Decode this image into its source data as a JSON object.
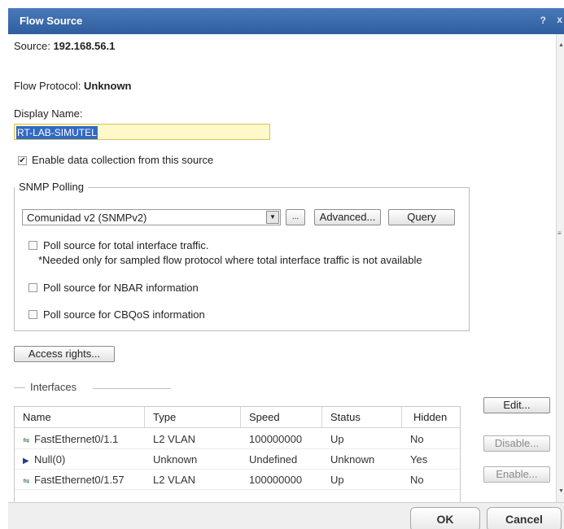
{
  "dialog": {
    "title": "Flow Source",
    "help": "?",
    "close": "x"
  },
  "source": {
    "label": "Source:",
    "value": "192.168.56.1"
  },
  "flow_protocol": {
    "label": "Flow Protocol:",
    "value": "Unknown"
  },
  "display_name": {
    "label": "Display Name:",
    "value": "RT-LAB-SIMUTEL"
  },
  "enable_collection": {
    "checked": true,
    "label": "Enable data collection from this source"
  },
  "snmp": {
    "legend": "SNMP Polling",
    "credential": "Comunidad v2 (SNMPv2)",
    "ellipsis_label": "...",
    "advanced_label": "Advanced...",
    "query_label": "Query",
    "poll_total": {
      "checked": false,
      "label": "Poll source for total interface traffic.",
      "note": "*Needed only for sampled flow protocol where total interface traffic is not available"
    },
    "poll_nbar": {
      "checked": false,
      "label": "Poll source for NBAR information"
    },
    "poll_cbqos": {
      "checked": false,
      "label": "Poll source for CBQoS information"
    }
  },
  "access_rights_label": "Access rights...",
  "interfaces": {
    "legend": "Interfaces",
    "columns": [
      "Name",
      "Type",
      "Speed",
      "Status",
      "Hidden"
    ],
    "rows": [
      {
        "icon": "ethernet-icon",
        "name": "FastEthernet0/1.1",
        "type": "L2 VLAN",
        "speed": "100000000",
        "status": "Up",
        "hidden": "No"
      },
      {
        "icon": "null-interface-icon",
        "name": "Null(0)",
        "type": "Unknown",
        "speed": "Undefined",
        "status": "Unknown",
        "hidden": "Yes"
      },
      {
        "icon": "ethernet-icon",
        "name": "FastEthernet0/1.57",
        "type": "L2 VLAN",
        "speed": "100000000",
        "status": "Up",
        "hidden": "No"
      }
    ],
    "edit_label": "Edit...",
    "disable_label": "Disable...",
    "enable_label": "Enable..."
  },
  "footer": {
    "ok_label": "OK",
    "cancel_label": "Cancel"
  },
  "colors": {
    "titlebar": "#3a68a8",
    "selection": "#3169c6",
    "input_bg": "#fff8c8"
  }
}
